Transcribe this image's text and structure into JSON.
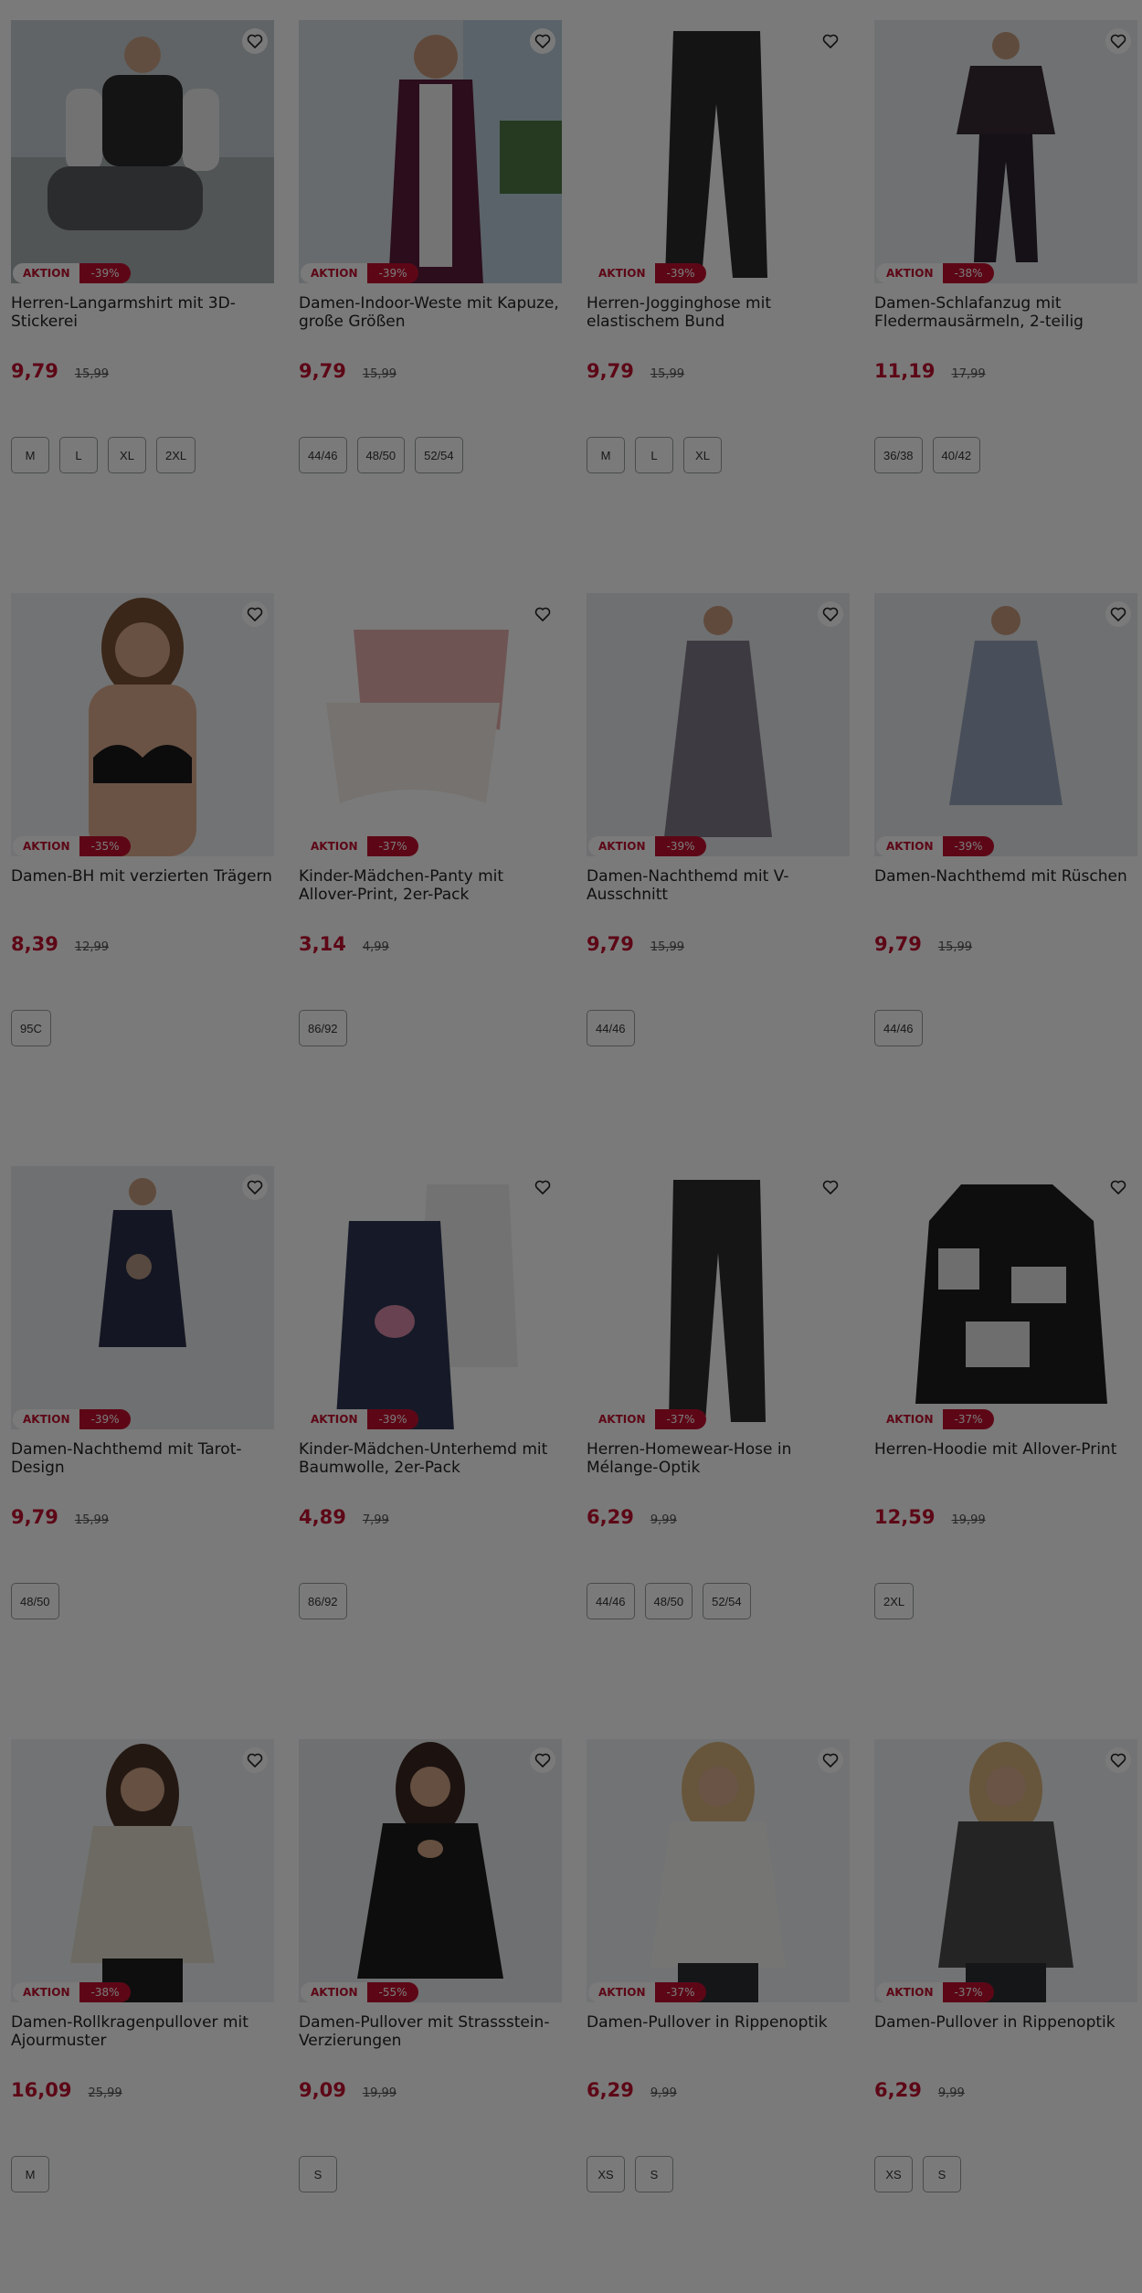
{
  "labels": {
    "aktion": "AKTION"
  },
  "colors": {
    "accent": "#c3102f",
    "overlay": "rgba(0,0,0,0.52)"
  },
  "products": [
    {
      "title": "Herren-Langarmshirt mit 3D-Stickerei",
      "price": "9,79",
      "old_price": "15,99",
      "discount": "-39%",
      "sizes": [
        "M",
        "L",
        "XL",
        "2XL"
      ],
      "image": "man-in-dark-shirt-with-white-sleeves"
    },
    {
      "title": "Damen-Indoor-Weste mit Kapuze, große Größen",
      "price": "9,79",
      "old_price": "15,99",
      "discount": "-39%",
      "sizes": [
        "44/46",
        "48/50",
        "52/54"
      ],
      "image": "woman-in-purple-vest"
    },
    {
      "title": "Herren-Jogginghose mit elastischem Bund",
      "price": "9,79",
      "old_price": "15,99",
      "discount": "-39%",
      "sizes": [
        "M",
        "L",
        "XL"
      ],
      "image": "black-jogging-pants"
    },
    {
      "title": "Damen-Schlafanzug mit Fledermausärmeln, 2-teilig",
      "price": "11,19",
      "old_price": "17,99",
      "discount": "-38%",
      "sizes": [
        "36/38",
        "40/42"
      ],
      "image": "woman-in-dark-pajamas"
    },
    {
      "title": "Damen-BH mit verzierten Trägern",
      "price": "8,39",
      "old_price": "12,99",
      "discount": "-35%",
      "sizes": [
        "95C"
      ],
      "image": "woman-in-black-bra"
    },
    {
      "title": "Kinder-Mädchen-Panty mit Allover-Print, 2er-Pack",
      "price": "3,14",
      "old_price": "4,99",
      "discount": "-37%",
      "sizes": [
        "86/92"
      ],
      "image": "two-girls-panties"
    },
    {
      "title": "Damen-Nachthemd mit V-Ausschnitt",
      "price": "9,79",
      "old_price": "15,99",
      "discount": "-39%",
      "sizes": [
        "44/46"
      ],
      "image": "woman-in-grey-nightgown"
    },
    {
      "title": "Damen-Nachthemd mit Rüschen",
      "price": "9,79",
      "old_price": "15,99",
      "discount": "-39%",
      "sizes": [
        "44/46"
      ],
      "image": "woman-in-patterned-nightgown"
    },
    {
      "title": "Damen-Nachthemd mit Tarot-Design",
      "price": "9,79",
      "old_price": "15,99",
      "discount": "-39%",
      "sizes": [
        "48/50"
      ],
      "image": "woman-in-navy-nightgown"
    },
    {
      "title": "Kinder-Mädchen-Unterhemd mit Baumwolle, 2er-Pack",
      "price": "4,89",
      "old_price": "7,99",
      "discount": "-39%",
      "sizes": [
        "86/92"
      ],
      "image": "two-girls-tanktops"
    },
    {
      "title": "Herren-Homewear-Hose in Mélange-Optik",
      "price": "6,29",
      "old_price": "9,99",
      "discount": "-37%",
      "sizes": [
        "44/46",
        "48/50",
        "52/54"
      ],
      "image": "dark-homewear-pants"
    },
    {
      "title": "Herren-Hoodie mit Allover-Print",
      "price": "12,59",
      "old_price": "19,99",
      "discount": "-37%",
      "sizes": [
        "2XL"
      ],
      "image": "black-white-print-hoodie"
    },
    {
      "title": "Damen-Rollkragenpullover mit Ajourmuster",
      "price": "16,09",
      "old_price": "25,99",
      "discount": "-38%",
      "sizes": [
        "M"
      ],
      "image": "woman-in-cream-turtleneck"
    },
    {
      "title": "Damen-Pullover mit Strassstein-Verzierungen",
      "price": "9,09",
      "old_price": "19,99",
      "discount": "-55%",
      "sizes": [
        "S"
      ],
      "image": "woman-in-black-cutout-top"
    },
    {
      "title": "Damen-Pullover in Rippenoptik",
      "price": "6,29",
      "old_price": "9,99",
      "discount": "-37%",
      "sizes": [
        "XS",
        "S"
      ],
      "image": "woman-in-white-ribbed-top"
    },
    {
      "title": "Damen-Pullover in Rippenoptik",
      "price": "6,29",
      "old_price": "9,99",
      "discount": "-37%",
      "sizes": [
        "XS",
        "S"
      ],
      "image": "woman-in-grey-ribbed-top"
    }
  ]
}
